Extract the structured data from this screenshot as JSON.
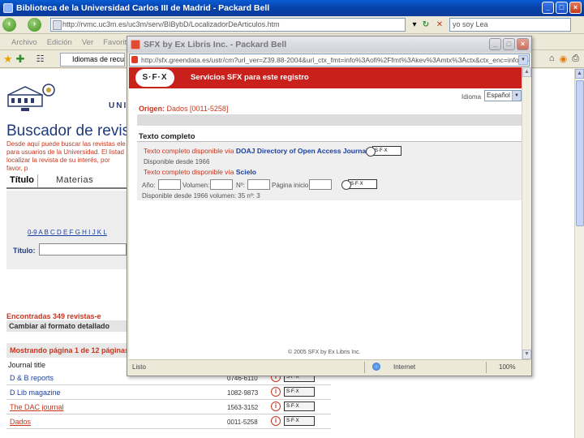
{
  "main_window": {
    "title": "Biblioteca de la Universidad Carlos III de Madrid - Packard Bell",
    "address": "http://rvmc.uc3m.es/uc3m/serv/BIBybD/LocalizadorDeArticulos.htm",
    "search_value": "yo soy Lea",
    "menu": [
      "Archivo",
      "Edición",
      "Ver",
      "Favoritos",
      "H"
    ],
    "tab_label": "Idiomas de recu"
  },
  "page": {
    "university_text": "UNIV",
    "heading": "Buscador de revis",
    "intro": "Desde aquí puede buscar las revistas ele para usuarios de la Universidad. El listad localizar la revista de su interés, por favor, p",
    "tabs": {
      "titulo": "Título",
      "materias": "Materias"
    },
    "alphabet": "0-9 A B C D E F G H I J K L",
    "titulo_label": "Título:",
    "found": "Encontradas 349 revistas-e",
    "format_link": "Cambiar al formato detallado",
    "paging": "Mostrando página 1 de 12 páginas.",
    "journal_col": "Journal title",
    "sfx_label": "S·F·X",
    "info_label": "i",
    "rows": [
      {
        "title": "D & B reports",
        "issn": "0746-6110"
      },
      {
        "title": "D Lib magazine",
        "issn": "1082-9873"
      },
      {
        "title": "The DAC journal",
        "issn": "1563-3152"
      },
      {
        "title": "Dados",
        "issn": "0011-5258"
      }
    ]
  },
  "sfx_window": {
    "title": "SFX by Ex Libris Inc. - Packard Bell",
    "address": "http://sfx.greendata.es/ustr/cm?url_ver=Z39.88-2004&url_ctx_fmt=info%3Aofi%2Ffmt%3Akev%3Amtx%3Actx&ctx_enc=info%3Aofi%2Fenc%3AUTF-8&url_ver=Z39.88",
    "logo": "S·F·X",
    "header_title": "Servicios SFX para este registro",
    "language_label": "Idioma",
    "language_value": "Español",
    "origin_label": "Origen:",
    "origin_value": "Dados [0011-5258]",
    "section_title": "Texto completo",
    "link1_prefix": "Texto completo disponible vía",
    "link1_target": "DOAJ Directory of Open Access Journals",
    "note1": "Disponible desde 1966",
    "link2_prefix": "Texto completo disponible vía",
    "link2_target": "Scielo",
    "form": {
      "ano": "Año:",
      "volumen": "Volumen:",
      "numero": "Nº:",
      "pagina": "Página inicio:"
    },
    "note2": "Disponible desde 1966 volumen: 35 nº: 3",
    "go_label": "S·F·X",
    "footer": "© 2005 SFX by Ex Libris Inc.",
    "status": {
      "done": "Listo",
      "zone": "Internet",
      "zoom": "100%"
    }
  }
}
